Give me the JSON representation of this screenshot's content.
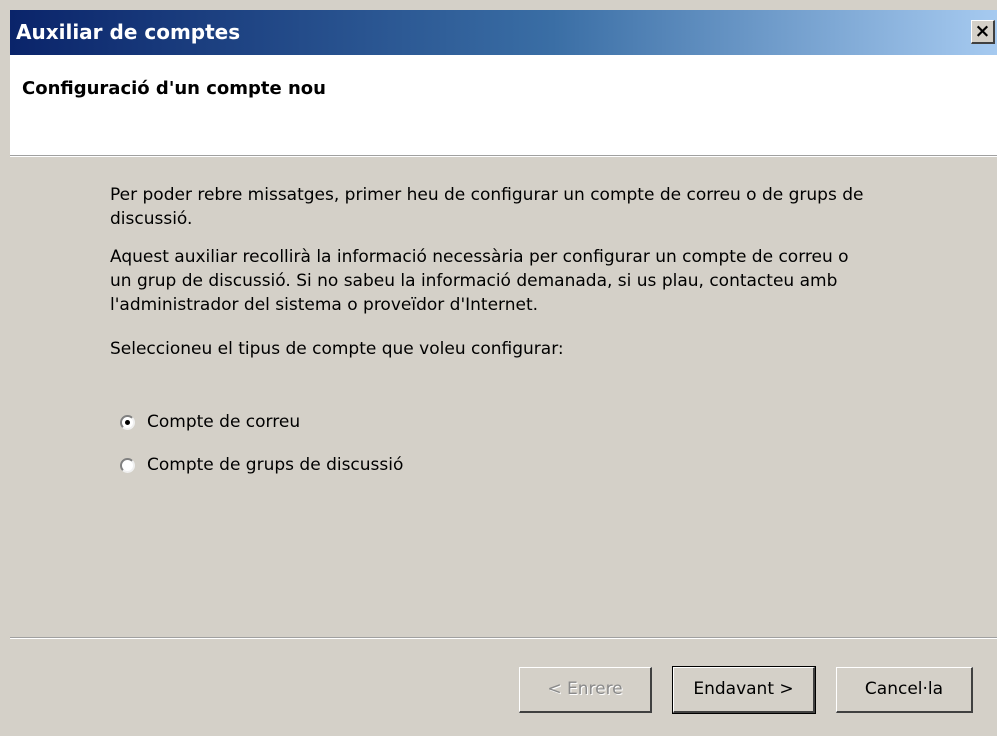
{
  "window": {
    "title": "Auxiliar de comptes",
    "close_glyph": "×"
  },
  "header": {
    "title": "Configuració d'un compte nou"
  },
  "content": {
    "paragraph1": "Per poder rebre missatges, primer heu de configurar un compte de correu o de grups de discussió.",
    "paragraph2": "Aquest auxiliar recollirà la informació necessària per configurar un compte de correu o un grup de discussió. Si no sabeu la informació demanada, si us plau, contacteu amb l'administrador del sistema o proveïdor d'Internet.",
    "paragraph3": "Seleccioneu el tipus de compte que voleu configurar:",
    "options": [
      {
        "label": "Compte de correu",
        "selected": true
      },
      {
        "label": "Compte de grups de discussió",
        "selected": false
      }
    ]
  },
  "buttons": {
    "back": "< Enrere",
    "next": "Endavant >",
    "cancel": "Cancel·la"
  }
}
